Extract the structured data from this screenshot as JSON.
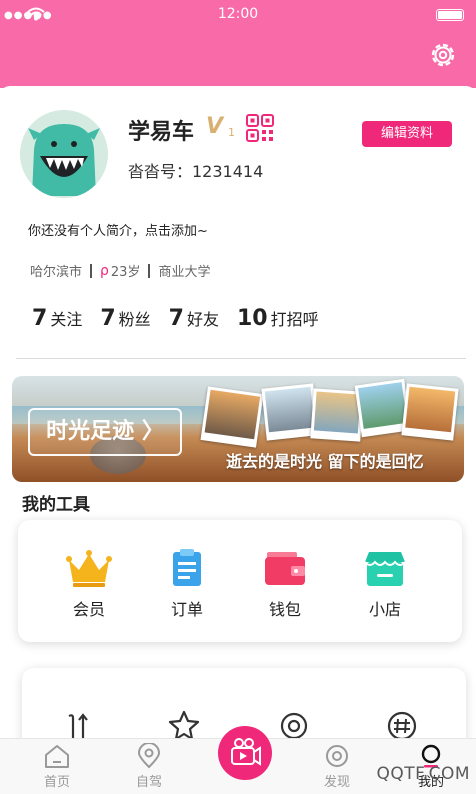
{
  "status_bar": {
    "time": "12:00"
  },
  "profile": {
    "name": "学易车",
    "vip_badge": "V",
    "vip_level": "1",
    "account_id": "沓沓号：1231414",
    "edit_button": "编辑资料",
    "bio": "你还没有个人简介，点击添加~",
    "city": "哈尔滨市",
    "age": "23岁",
    "school": "商业大学",
    "stats": [
      {
        "value": "7",
        "label": "关注"
      },
      {
        "value": "7",
        "label": "粉丝"
      },
      {
        "value": "7",
        "label": "好友"
      },
      {
        "value": "10",
        "label": "打招呼"
      }
    ]
  },
  "banner": {
    "button_label": "时光足迹 〉",
    "caption": "逝去的是时光 留下的是回忆"
  },
  "tools": {
    "title": "我的工具",
    "items": [
      {
        "label": "会员",
        "icon": "crown-icon"
      },
      {
        "label": "订单",
        "icon": "clipboard-icon"
      },
      {
        "label": "钱包",
        "icon": "wallet-icon"
      },
      {
        "label": "小店",
        "icon": "store-icon"
      }
    ]
  },
  "tabbar": {
    "items": [
      {
        "label": "首页",
        "icon": "home-icon"
      },
      {
        "label": "自驾",
        "icon": "map-pin-icon"
      },
      {
        "label": "",
        "icon": "video-camera-icon"
      },
      {
        "label": "发现",
        "icon": "discover-icon"
      },
      {
        "label": "我的",
        "icon": "profile-icon"
      }
    ],
    "active": "我的"
  },
  "watermark": "QQTF.COM",
  "colors": {
    "header": "#f86ba8",
    "accent": "#f0287a",
    "vip": "#d8b070"
  }
}
